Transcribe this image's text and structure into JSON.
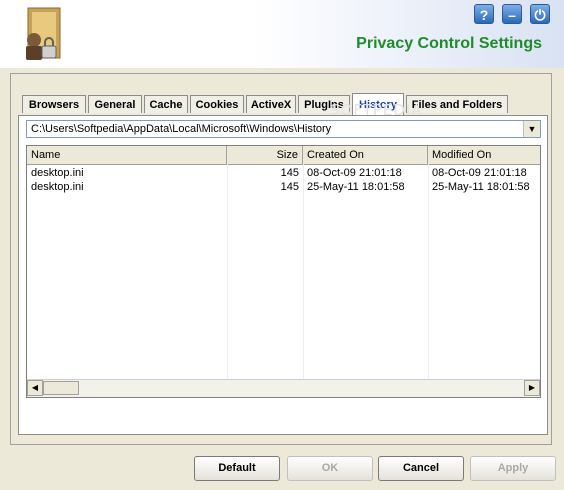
{
  "header": {
    "title": "Privacy Control Settings",
    "help_icon": "question-icon",
    "minimize_icon": "minimize-icon",
    "power_icon": "power-icon"
  },
  "tabs": [
    {
      "label": "Browsers",
      "active": false
    },
    {
      "label": "General",
      "active": false
    },
    {
      "label": "Cache",
      "active": false
    },
    {
      "label": "Cookies",
      "active": false
    },
    {
      "label": "ActiveX",
      "active": false
    },
    {
      "label": "PlugIns",
      "active": false
    },
    {
      "label": "History",
      "active": true
    },
    {
      "label": "Files and Folders",
      "active": false
    }
  ],
  "path_select": {
    "value": "C:\\Users\\Softpedia\\AppData\\Local\\Microsoft\\Windows\\History"
  },
  "watermark": "SOFTPEDIA",
  "file_list": {
    "columns": [
      "Name",
      "Size",
      "Created On",
      "Modified On"
    ],
    "rows": [
      [
        "desktop.ini",
        "145",
        "08-Oct-09 21:01:18",
        "08-Oct-09 21:01:18"
      ],
      [
        "desktop.ini",
        "145",
        "25-May-11 18:01:58",
        "25-May-11 18:01:58"
      ]
    ]
  },
  "buttons": {
    "default": "Default",
    "ok": "OK",
    "cancel": "Cancel",
    "apply": "Apply"
  }
}
